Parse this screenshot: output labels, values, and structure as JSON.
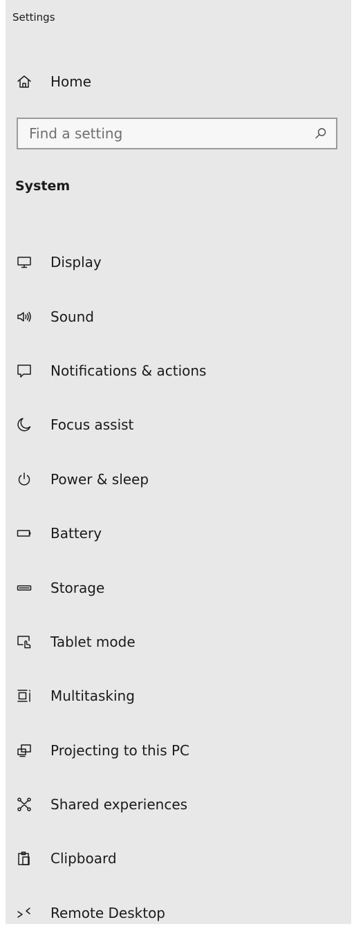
{
  "app": {
    "title": "Settings"
  },
  "home": {
    "label": "Home",
    "icon": "home-icon"
  },
  "search": {
    "placeholder": "Find a setting",
    "value": "",
    "icon": "search-icon"
  },
  "section": {
    "title": "System"
  },
  "nav": {
    "items": [
      {
        "label": "Display",
        "icon": "display-icon"
      },
      {
        "label": "Sound",
        "icon": "sound-icon"
      },
      {
        "label": "Notifications & actions",
        "icon": "notifications-icon"
      },
      {
        "label": "Focus assist",
        "icon": "moon-icon"
      },
      {
        "label": "Power & sleep",
        "icon": "power-icon"
      },
      {
        "label": "Battery",
        "icon": "battery-icon"
      },
      {
        "label": "Storage",
        "icon": "storage-icon"
      },
      {
        "label": "Tablet mode",
        "icon": "tablet-mode-icon"
      },
      {
        "label": "Multitasking",
        "icon": "multitasking-icon"
      },
      {
        "label": "Projecting to this PC",
        "icon": "projecting-icon"
      },
      {
        "label": "Shared experiences",
        "icon": "shared-experiences-icon"
      },
      {
        "label": "Clipboard",
        "icon": "clipboard-icon"
      },
      {
        "label": "Remote Desktop",
        "icon": "remote-desktop-icon"
      }
    ]
  },
  "colors": {
    "panel_background": "#e8e8e8",
    "text": "#1a1a1a",
    "search_border": "#9a9a9a"
  }
}
